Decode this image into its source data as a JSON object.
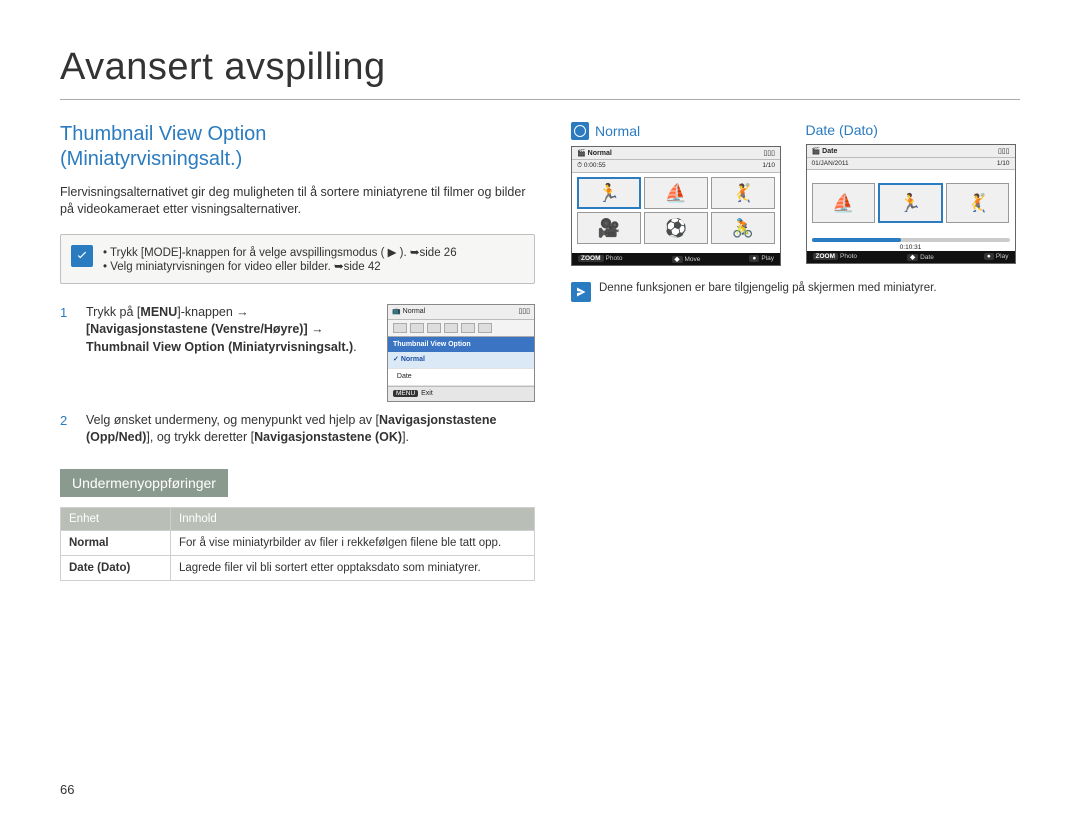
{
  "page": {
    "title": "Avansert avspilling",
    "number": "66"
  },
  "section": {
    "heading_line1": "Thumbnail View Option",
    "heading_line2": "(Miniatyrvisningsalt.)",
    "intro": "Flervisningsalternativet gir deg muligheten til å sortere miniatyrene til filmer og bilder på videokameraet etter visningsalternativer."
  },
  "note1": {
    "items": [
      "Trykk [MODE]-knappen for å velge avspillingsmodus ( ▶ ). ➥side 26",
      "Velg miniatyrvisningen for video eller bilder. ➥side 42"
    ]
  },
  "steps": {
    "s1_a": "Trykk på [",
    "s1_menu": "MENU",
    "s1_b": "]-knappen →",
    "s1_c": "[Navigasjonstastene (Venstre/Høyre)] → Thumbnail View Option (Miniatyrvisningsalt.)",
    "s1_end": ".",
    "s2_a": "Velg ønsket undermeny, og menypunkt ved hjelp av [",
    "s2_nav1": "Navigasjonstastene (Opp/Ned)",
    "s2_b": "], og trykk deretter [",
    "s2_nav2": "Navigasjonstastene (OK)",
    "s2_c": "]."
  },
  "miniscreen": {
    "top_label": "Normal",
    "menu_header": "Thumbnail View Option",
    "item_normal": "Normal",
    "item_date": "Date",
    "exit_btn": "MENU",
    "exit_label": "Exit"
  },
  "submenu": {
    "heading": "Undermenyoppføringer",
    "col_unit": "Enhet",
    "col_content": "Innhold",
    "rows": [
      {
        "k": "Normal",
        "v": "For å vise miniatyrbilder av filer i rekkefølgen filene ble tatt opp."
      },
      {
        "k": "Date (Dato)",
        "v": "Lagrede filer vil bli sortert etter opptaksdato som miniatyrer."
      }
    ]
  },
  "right": {
    "normal_title": "Normal",
    "date_title": "Date (Dato)",
    "normal_screen": {
      "top": "Normal",
      "counter": "1/10",
      "time": "0:00:55",
      "bot_zoom": "ZOOM",
      "bot_photo": "Photo",
      "bot_move_k": "",
      "bot_move": "Move",
      "bot_play_k": "",
      "bot_play": "Play"
    },
    "date_screen": {
      "top": "Date",
      "date_label": "01/JAN/2011",
      "counter": "1/10",
      "time": "0:10:31",
      "bot_zoom": "ZOOM",
      "bot_photo": "Photo",
      "bot_date_k": "",
      "bot_date": "Date",
      "bot_play_k": "",
      "bot_play": "Play"
    },
    "footnote": "Denne funksjonen er bare tilgjengelig på skjermen med miniatyrer."
  }
}
